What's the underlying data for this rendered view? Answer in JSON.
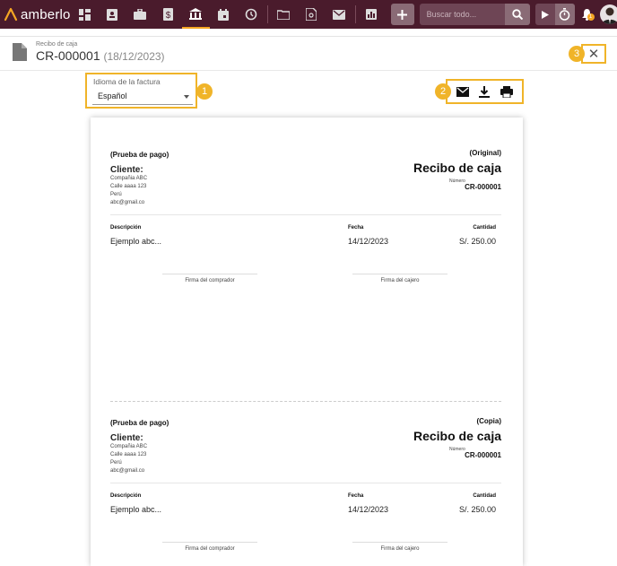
{
  "app": {
    "name": "amberlo"
  },
  "search": {
    "placeholder": "Buscar todo..."
  },
  "notifications": {
    "count": "1"
  },
  "header": {
    "subtitle": "Recibo de caja",
    "doc_number": "CR-000001",
    "doc_date": "(18/12/2023)",
    "close_label": "✕"
  },
  "language": {
    "label": "Idioma de la factura",
    "value": "Español"
  },
  "markers": [
    "1",
    "2",
    "3"
  ],
  "receipts": [
    {
      "proof": "(Prueba de pago)",
      "copy_type": "(Original)",
      "title": "Recibo de caja",
      "client_label": "Cliente:",
      "client_lines": [
        "Compañia ABC",
        "Calle aaaa 123",
        "Perú",
        "abc@gmail.co"
      ],
      "number_label": "Número",
      "number": "CR-000001",
      "col_desc": "Descripción",
      "col_date": "Fecha",
      "col_amount": "Cantidad",
      "row_desc": "Ejemplo abc...",
      "row_date": "14/12/2023",
      "row_amount": "S/. 250.00",
      "sig_buyer": "Firma del comprador",
      "sig_cashier": "Firma del cajero"
    },
    {
      "proof": "(Prueba de pago)",
      "copy_type": "(Copia)",
      "title": "Recibo de caja",
      "client_label": "Cliente:",
      "client_lines": [
        "Compañia ABC",
        "Calle aaaa 123",
        "Perú",
        "abc@gmail.co"
      ],
      "number_label": "Número",
      "number": "CR-000001",
      "col_desc": "Descripción",
      "col_date": "Fecha",
      "col_amount": "Cantidad",
      "row_desc": "Ejemplo abc...",
      "row_date": "14/12/2023",
      "row_amount": "S/. 250.00",
      "sig_buyer": "Firma del comprador",
      "sig_cashier": "Firma del cajero"
    }
  ],
  "colors": {
    "topbar": "#4a1b2c",
    "accent": "#f5a623",
    "highlight": "#f0b429"
  }
}
